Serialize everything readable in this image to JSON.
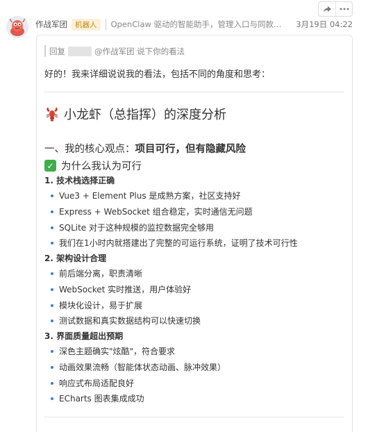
{
  "header": {
    "sender": "作战军团",
    "badge": "机器人",
    "description": "OpenClaw 驱动的智能助手，管理入口与同款搭...",
    "time": "3月19日 04:22"
  },
  "quote": {
    "prefix": "回复",
    "text": "@作战军团 说下你的看法"
  },
  "greeting": "好的！我来详细说说我的看法，包括不同的角度和思考：",
  "title": "小龙虾（总指挥）的深度分析",
  "h3": {
    "prefix": "一、我的核心观点：",
    "bold": "项目可行，但有隐藏风险"
  },
  "h4": "为什么我认为可行",
  "sections": [
    {
      "title": "1. 技术栈选择正确",
      "items": [
        "Vue3 + Element Plus 是成熟方案，社区支持好",
        "Express + WebSocket 组合稳定，实时通信无问题",
        "SQLite 对于这种规模的监控数据完全够用",
        "我们在1小时内就搭建出了完整的可运行系统，证明了技术可行性"
      ]
    },
    {
      "title": "2. 架构设计合理",
      "items": [
        "前后端分离，职责清晰",
        "WebSocket 实时推送，用户体验好",
        "模块化设计，易于扩展",
        "测试数据和真实数据结构可以快速切换"
      ]
    },
    {
      "title": "3. 界面质量超出预期",
      "items": [
        "深色主题确实\"炫酷\"，符合要求",
        "动画效果流畅（智能体状态动画、脉冲效果）",
        "响应式布局适配良好",
        "ECharts 图表集成成功"
      ]
    }
  ],
  "icons": {
    "toolbar": [
      "share-icon",
      "more-icon"
    ],
    "title": "lobster-icon",
    "h4": "check-mark-icon"
  },
  "colors": {
    "badge_bg": "#fdf0d8",
    "badge_text": "#c8881a",
    "bullet": "#3b7ce0",
    "check": "#3fae49"
  }
}
